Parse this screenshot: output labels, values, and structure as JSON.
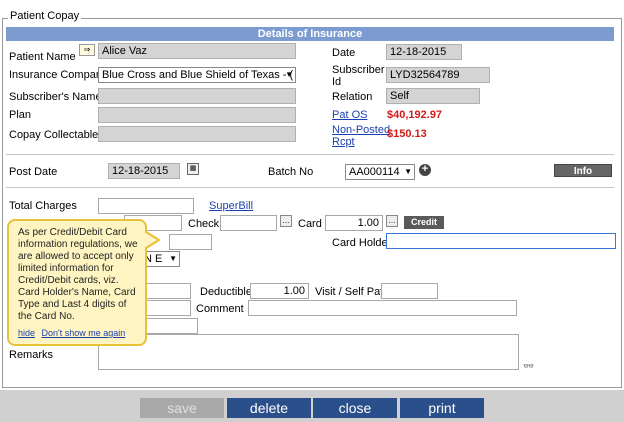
{
  "section_title": "Patient Copay",
  "header": "Details of Insurance",
  "labels": {
    "patient_name": "Patient Name",
    "insurance_company": "Insurance Company",
    "subscribers_name": "Subscriber's Name",
    "plan": "Plan",
    "copay_collectable": "Copay Collectable",
    "date": "Date",
    "subscriber_id_1": "Subscriber",
    "subscriber_id_2": "Id",
    "relation": "Relation",
    "post_date": "Post Date",
    "batch_no": "Batch No",
    "total_charges": "Total Charges",
    "check": "Check",
    "card": "Card",
    "card_holder": "Card Holder",
    "deductible": "Deductible",
    "visit_self_pay": "Visit / Self Pay",
    "comment": "Comment",
    "remarks": "Remarks"
  },
  "values": {
    "patient_name": "Alice Vaz",
    "insurance_company": "Blue Cross and Blue Shield of Texas - ( P",
    "date": "12-18-2015",
    "subscriber_id": "LYD32564789",
    "relation": "Self",
    "post_date": "12-18-2015",
    "batch_no": "AA000114",
    "card_amount": "1.00",
    "deductible": "1.00",
    "partial_select": "N E",
    "pat_os_amount": "$40,192.97",
    "non_posted_amount": "$150.13"
  },
  "links": {
    "pat_os": "Pat OS",
    "non_posted_1": "Non-Posted",
    "non_posted_2": "Rcpt",
    "superbill": "SuperBill"
  },
  "buttons": {
    "info": "Info",
    "credit": "Credit",
    "save": "save",
    "delete": "delete",
    "close": "close",
    "print": "print"
  },
  "tooltip": {
    "text": "As per Credit/Debit Card information regulations, we are allowed to accept only limited information for Credit/Debit cards, viz. Card Holder's Name, Card Type and Last 4 digits of the Card No.",
    "hide": "hide",
    "dont_show": "Don't show me again"
  },
  "colors": {
    "header_bg": "#7c9bd1",
    "amount_red": "#d21c1c",
    "button_blue": "#2b4f8a",
    "tooltip_bg": "#fff5c2"
  }
}
